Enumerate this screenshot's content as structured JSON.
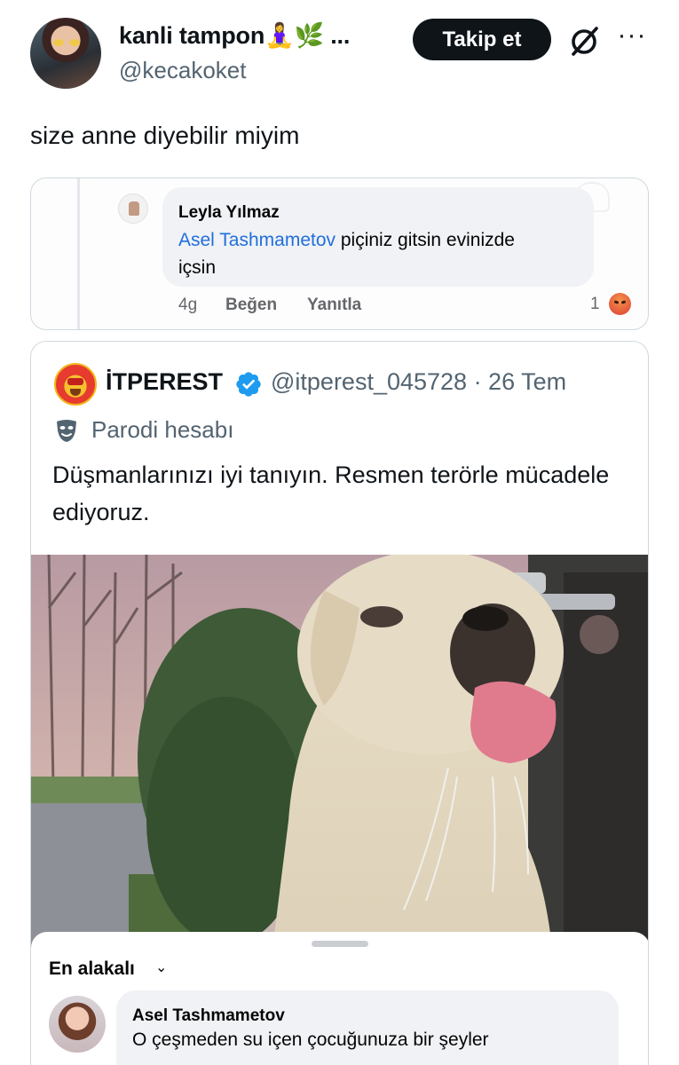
{
  "header": {
    "display_name": "kanli tampon🧘‍♀️🌿 ...",
    "handle": "@kecakoket",
    "follow_label": "Takip et"
  },
  "tweet": {
    "text": "size anne diyebilir miyim"
  },
  "facebook_comment": {
    "author": "Leyla Yılmaz",
    "mention": "Asel Tashmametov",
    "text_line1_rest": " piçiniz gitsin evinizde",
    "text_line2": "içsin",
    "time": "4g",
    "like_label": "Beğen",
    "reply_label": "Yanıtla",
    "reaction_count": "1"
  },
  "quoted_tweet": {
    "name": "İTPEREST",
    "handle_time": "@itperest_045728 · 26 Tem",
    "label": "Parodi hesabı",
    "text": "Düşmanlarınızı iyi tanıyın. Resmen terörle mücadele ediyoruz."
  },
  "media_overlay": {
    "sort_label": "En alakalı",
    "comment_author": "Asel Tashmametov",
    "comment_text": "O çeşmeden su içen çocuğunuza bir şeyler"
  },
  "colors": {
    "accent_blue": "#1d9bf0",
    "text_primary": "#0f1419",
    "text_secondary": "#536471",
    "border": "#cfd9de",
    "fb_mention": "#216fdb"
  },
  "icons": {
    "grok": "grok-slash-icon",
    "more": "more-dots-icon",
    "verified": "verified-badge-icon",
    "parody": "parody-mask-icon",
    "angry": "angry-reaction-icon"
  }
}
